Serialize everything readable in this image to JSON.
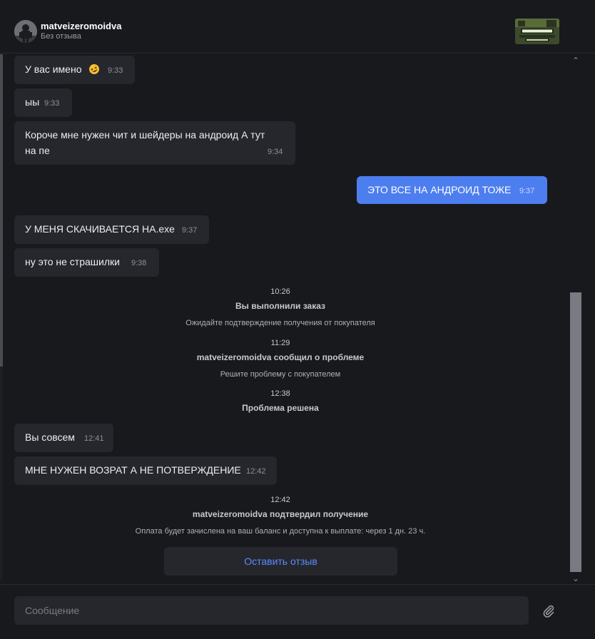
{
  "header": {
    "username": "matveizeromoidva",
    "status": "Без отзыва"
  },
  "messages": [
    {
      "dir": "in",
      "text": "У вас имено",
      "time": "9:33",
      "emoji": "rofl-emoji"
    },
    {
      "dir": "in",
      "text": "ыы",
      "time": "9:33"
    },
    {
      "dir": "in",
      "text_line1": "Короче мне нужен чит и шейдеры на андроид А тут",
      "text_line2": "на пе",
      "time": "9:34"
    },
    {
      "dir": "out",
      "text": "ЭТО ВСЕ НА АНДРОИД ТОЖЕ",
      "time": "9:37"
    },
    {
      "dir": "in",
      "text": "У МЕНЯ СКАЧИВАЕТСЯ НА.exe",
      "time": "9:37"
    },
    {
      "dir": "in",
      "text": "ну это не страшилки",
      "time": "9:38"
    },
    {
      "dir": "in",
      "text": "Вы совсем",
      "time": "12:41"
    },
    {
      "dir": "in",
      "text": "МНЕ НУЖЕН ВОЗРАТ А НЕ ПОТВЕРЖДЕНИЕ",
      "time": "12:42"
    }
  ],
  "system_events": [
    {
      "time": "10:26",
      "title": "Вы выполнили заказ",
      "desc": "Ожидайте подтверждение получения от покупателя"
    },
    {
      "time": "11:29",
      "title": "matveizeromoidva сообщил о проблеме",
      "desc": "Решите проблему с покупателем"
    },
    {
      "time": "12:38",
      "title": "Проблема решена"
    },
    {
      "time": "12:42",
      "title": "matveizeromoidva подтвердил получение",
      "desc": "Оплата будет зачислена на ваш баланс и доступна к выплате: через 1 дн. 23 ч."
    }
  ],
  "review_button_label": "Оставить отзыв",
  "composer": {
    "placeholder": "Сообщение",
    "attach_icon": "paperclip-icon"
  },
  "colors": {
    "background": "#18191d",
    "bubble_in": "#26272d",
    "bubble_out": "#4d7ef0",
    "link": "#5b8cff"
  }
}
